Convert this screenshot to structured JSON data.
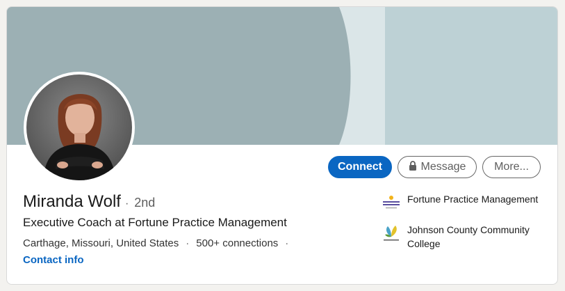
{
  "profile": {
    "name": "Miranda Wolf",
    "degree": "2nd",
    "headline": "Executive Coach at Fortune Practice Management",
    "location": "Carthage, Missouri, United States",
    "connections": "500+ connections",
    "contact_label": "Contact info"
  },
  "actions": {
    "connect": "Connect",
    "message": "Message",
    "more": "More..."
  },
  "organizations": [
    {
      "name": "Fortune Practice Management",
      "logo_icon": "fortune-practice-management-logo"
    },
    {
      "name": "Johnson County Community College",
      "logo_icon": "johnson-county-community-college-logo"
    }
  ],
  "colors": {
    "primary": "#0a66c2",
    "banner_dark": "#9cb0b4",
    "banner_light": "#dbe6e8",
    "banner_mid": "#bdd1d5"
  }
}
